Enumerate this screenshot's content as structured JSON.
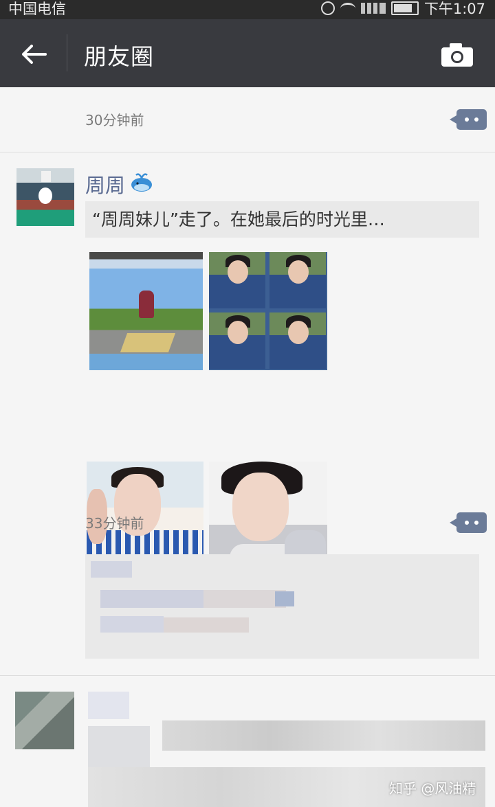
{
  "status_bar": {
    "carrier": "中国电信",
    "time": "下午1:07"
  },
  "nav": {
    "back_icon": "arrow-left-icon",
    "title": "朋友圈",
    "camera_icon": "camera-icon"
  },
  "feed": {
    "prev_post_time": "30分钟前",
    "post": {
      "username": "周周",
      "share_title": "“周周妹儿”走了。在她最后的时光里…",
      "time": "33分钟前"
    }
  },
  "watermark": "知乎 @风油精",
  "colors": {
    "navbar": "#393a3f",
    "status_bar": "#2b2b2b",
    "username": "#5b6b92",
    "comment_button": "#6b7b98",
    "background": "#f5f5f5"
  }
}
